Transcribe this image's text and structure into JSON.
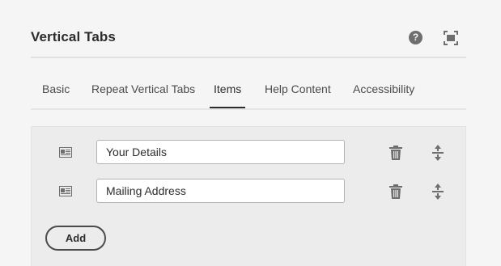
{
  "dialog": {
    "title": "Vertical Tabs",
    "help_icon": "help-circle-icon",
    "fullscreen_icon": "fullscreen-icon",
    "help_glyph": "?"
  },
  "tabs": [
    {
      "label": "Basic",
      "active": false
    },
    {
      "label": "Repeat Vertical Tabs",
      "active": false
    },
    {
      "label": "Items",
      "active": true
    },
    {
      "label": "Help Content",
      "active": false
    },
    {
      "label": "Accessibility",
      "active": false
    }
  ],
  "items": [
    {
      "value": "Your Details",
      "handle_icon": "drag-handle-icon",
      "delete_icon": "trash-icon",
      "move_icon": "move-vertical-icon"
    },
    {
      "value": "Mailing Address",
      "handle_icon": "drag-handle-icon",
      "delete_icon": "trash-icon",
      "move_icon": "move-vertical-icon"
    }
  ],
  "add_button": {
    "label": "Add"
  },
  "colors": {
    "background": "#f5f5f5",
    "panel": "#ececec",
    "text": "#2c2c2c",
    "icon": "#6e6e6e"
  }
}
